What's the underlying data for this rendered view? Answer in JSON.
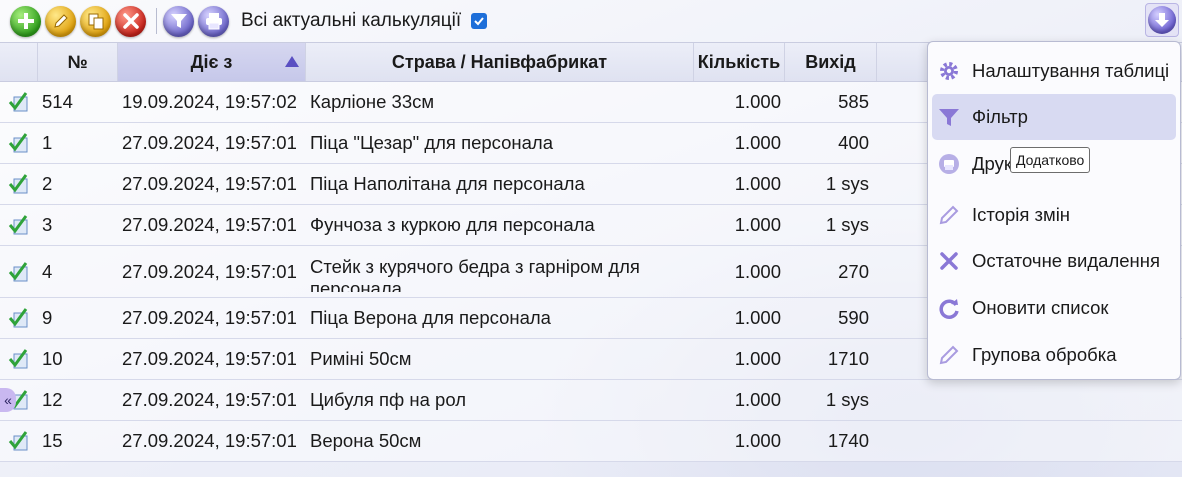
{
  "toolbar": {
    "buttons": [
      {
        "icon": "add-icon",
        "color": "#2f9f1c"
      },
      {
        "icon": "pencil-icon",
        "color": "#e0a10c"
      },
      {
        "icon": "copy-icon",
        "color": "#e0a10c"
      },
      {
        "icon": "close-icon",
        "color": "#c9231b"
      },
      {
        "icon": "filter-icon",
        "color": "#6a63c9"
      },
      {
        "icon": "printer-icon",
        "color": "#6a63c9"
      }
    ],
    "title": "Всі актуальні калькуляції",
    "checkbox_checked": true,
    "more_icon": "arrow-down-icon"
  },
  "table": {
    "columns": {
      "num": "№",
      "date": "Діє з",
      "name": "Страва / Напівфабрикат",
      "qty": "Кількість",
      "out": "Вихід"
    },
    "sorted_column": "date",
    "sort_direction": "ascending",
    "rows": [
      {
        "num": "514",
        "date": "19.09.2024, 19:57:02",
        "name": "Карліоне 33см",
        "qty": "1.000",
        "out": "585"
      },
      {
        "num": "1",
        "date": "27.09.2024, 19:57:01",
        "name": "Піца \"Цезар\" для персонала",
        "qty": "1.000",
        "out": "400"
      },
      {
        "num": "2",
        "date": "27.09.2024, 19:57:01",
        "name": "Піца Наполітана для персонала",
        "qty": "1.000",
        "out": "1 sys"
      },
      {
        "num": "3",
        "date": "27.09.2024, 19:57:01",
        "name": "Фунчоза з куркою для персонала",
        "qty": "1.000",
        "out": "1 sys"
      },
      {
        "num": "4",
        "date": "27.09.2024, 19:57:01",
        "name": "Стейк з курячого бедра з гарніром для персонала",
        "qty": "1.000",
        "out": "270"
      },
      {
        "num": "9",
        "date": "27.09.2024, 19:57:01",
        "name": "Піца Верона для персонала",
        "qty": "1.000",
        "out": "590"
      },
      {
        "num": "10",
        "date": "27.09.2024, 19:57:01",
        "name": "Риміні 50см",
        "qty": "1.000",
        "out": "1710"
      },
      {
        "num": "12",
        "date": "27.09.2024, 19:57:01",
        "name": "Цибуля пф на рол",
        "qty": "1.000",
        "out": "1 sys"
      },
      {
        "num": "15",
        "date": "27.09.2024, 19:57:01",
        "name": "Верона 50см",
        "qty": "1.000",
        "out": "1740"
      }
    ]
  },
  "menu": {
    "items": [
      {
        "label": "Налаштування таблиці",
        "icon": "gear-icon"
      },
      {
        "label": "Фільтр",
        "icon": "filter-icon",
        "active": true
      },
      {
        "label": "Друк",
        "icon": "printer-icon"
      },
      {
        "label": "Історія змін",
        "icon": "pencil-icon"
      },
      {
        "label": "Остаточне видалення",
        "icon": "delete-icon"
      },
      {
        "label": "Оновити список",
        "icon": "refresh-icon"
      },
      {
        "label": "Групова обробка",
        "icon": "pencil-icon"
      }
    ]
  },
  "tooltip": "Додатково",
  "sidebar_toggle": "«",
  "colors": {
    "accent": "#6b5fd1",
    "menu_active": "#d8daf2"
  }
}
